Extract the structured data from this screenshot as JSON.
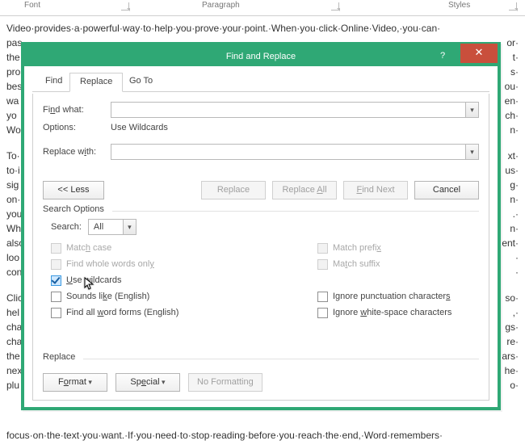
{
  "ribbon": {
    "font": "Font",
    "paragraph": "Paragraph",
    "styles": "Styles"
  },
  "doc": {
    "l1": "Video·provides·a·powerful·way·to·help·you·prove·your·point.·When·you·click·Online·Video,·you·can·",
    "l2": "pas",
    "l3": "the",
    "l4": "pro",
    "l5": "bes",
    "l6": "wa",
    "l7": "yo",
    "l8": "Wo",
    "l9": "To·",
    "l10": "to·i",
    "l11": "sig",
    "l12": "on·",
    "l13": "you",
    "l14": "Wh",
    "l15": "also",
    "l16": "loo",
    "l17": "con",
    "l18": "Clic",
    "l19": "hel",
    "l20": "cha",
    "l21": "cha",
    "l22": "the",
    "l23": "nex",
    "l24": "plu",
    "l25": "focus·on·the·text·you·want.·If·you·need·to·stop·reading·before·you·reach·the·end,·Word·remembers·",
    "r2": "or·",
    "r3": "t·",
    "r4": "s·",
    "r5": "ou·",
    "r6": "en·",
    "r7": "ch·",
    "r8": "n·",
    "r9": "xt·",
    "r10": "us·",
    "r11": "g·",
    "r12": "n·",
    "r13": ".·",
    "r14": "n·",
    "r15": "ent·",
    "r16": "·",
    "r17": "·",
    "r18": "so·",
    "r19": ",·",
    "r20": "gs·",
    "r21": "re·",
    "r22": "ars·",
    "r23": "he·",
    "r24": "o·"
  },
  "dialog": {
    "title": "Find and Replace",
    "tabs": {
      "find": "Find",
      "replace": "Replace",
      "goto": "Go To"
    },
    "findwhat_label": "Find what:",
    "options_label": "Options:",
    "options_value": "Use Wildcards",
    "replacewith_label": "Replace with:",
    "buttons": {
      "less": "<<  Less",
      "replace": "Replace",
      "replaceall": "Replace All",
      "findnext": "Find Next",
      "cancel": "Cancel"
    },
    "search_options_label": "Search Options",
    "search_label": "Search:",
    "search_value": "All",
    "checks": {
      "matchcase": "Match case",
      "wholewords": "Find whole words only",
      "wildcards": "Use wildcards",
      "soundslike": "Sounds like (English)",
      "wordforms": "Find all word forms (English)",
      "matchprefix": "Match prefix",
      "matchsuffix": "Match suffix",
      "ignorepunct": "Ignore punctuation characters",
      "ignorews": "Ignore white-space characters"
    },
    "replace_section": "Replace",
    "buttons2": {
      "format": "Format",
      "special": "Special",
      "noformat": "No Formatting"
    }
  }
}
